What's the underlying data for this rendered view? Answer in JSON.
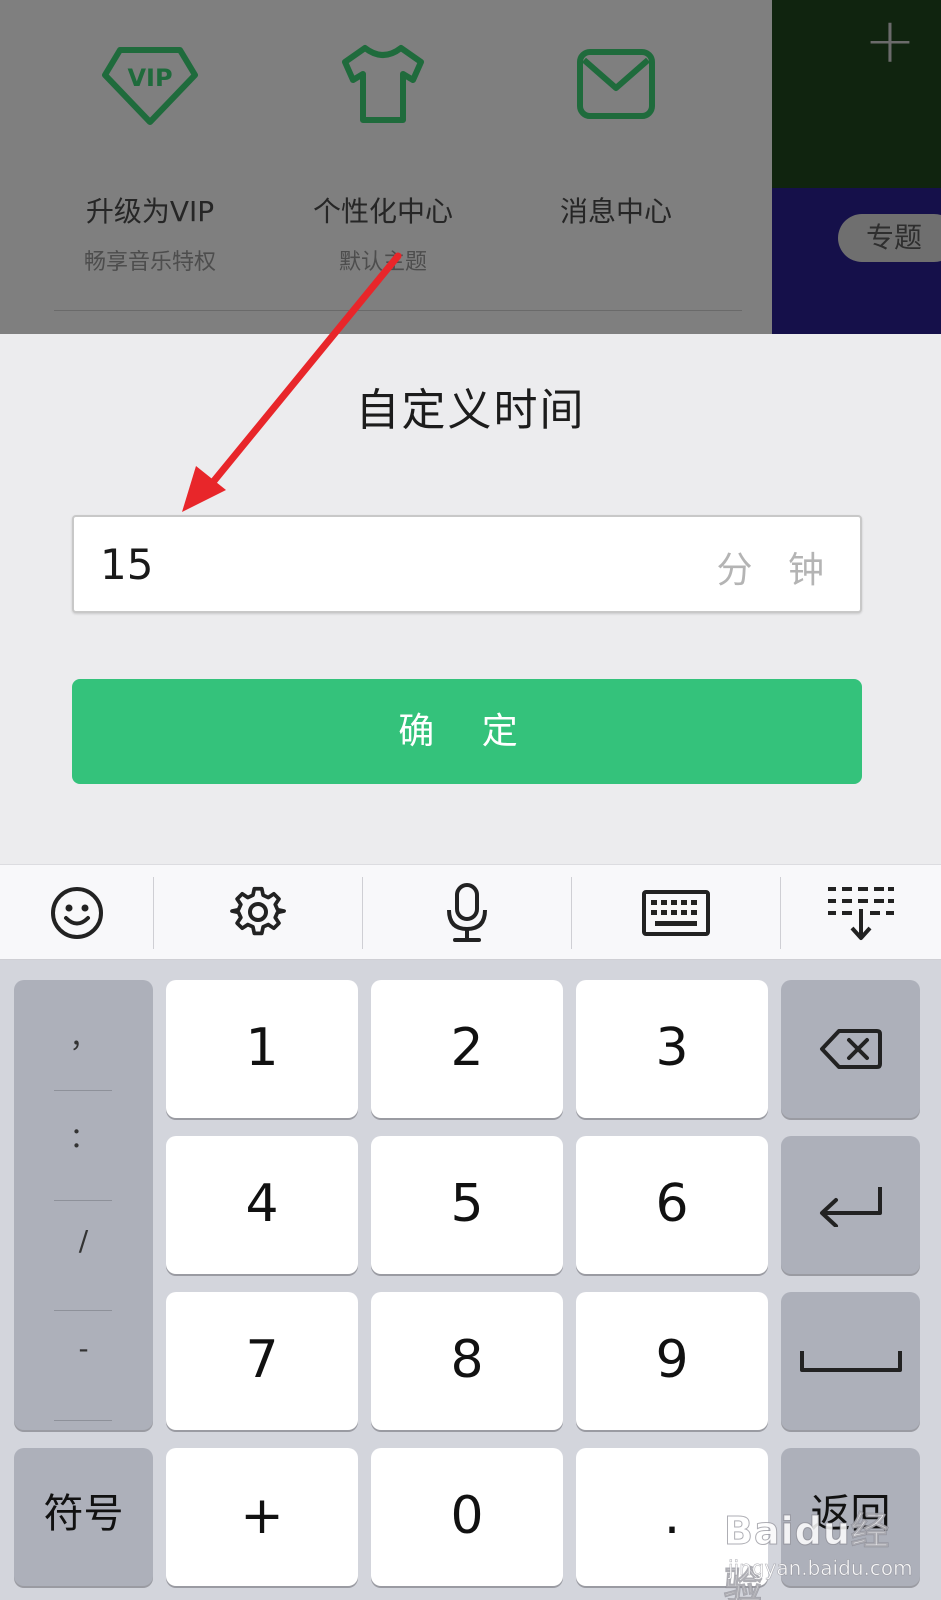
{
  "background_app": {
    "menu": [
      {
        "label": "升级为VIP",
        "sub": "畅享音乐特权",
        "icon": "vip-diamond-icon"
      },
      {
        "label": "个性化中心",
        "sub": "默认主题",
        "icon": "tshirt-icon"
      },
      {
        "label": "消息中心",
        "sub": "",
        "icon": "envelope-icon"
      }
    ],
    "right_tag": "专题",
    "accent_color": "#1f7a45"
  },
  "dialog": {
    "title": "自定义时间",
    "minutes_value": "15",
    "unit": "分 钟",
    "confirm_label": "确 定",
    "confirm_color": "#34c27b"
  },
  "annotation": {
    "color": "#e8262a"
  },
  "keyboard": {
    "toolbar": [
      "emoji-icon",
      "gear-icon",
      "microphone-icon",
      "keyboard-icon",
      "collapse-keyboard-icon"
    ],
    "symbols": [
      "，",
      "：",
      "/",
      "-"
    ],
    "keys": {
      "k1": "1",
      "k2": "2",
      "k3": "3",
      "k4": "4",
      "k5": "5",
      "k6": "6",
      "k7": "7",
      "k8": "8",
      "k9": "9",
      "plus": "+",
      "k0": "0",
      "dot": "."
    },
    "symbols_label": "符号",
    "return_label": "返回"
  },
  "watermark": {
    "brand": "Baidu经验",
    "url": "jingyan.baidu.com"
  }
}
